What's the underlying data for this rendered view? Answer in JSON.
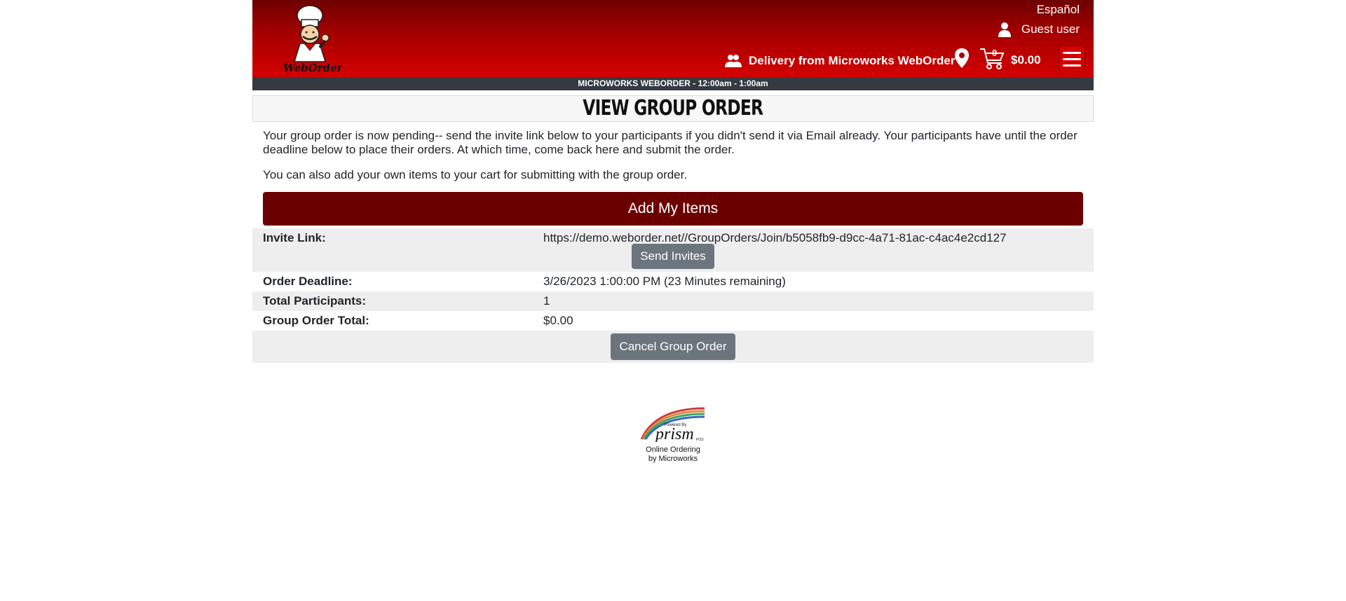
{
  "header": {
    "language_link": "Español",
    "user_name": "Guest user",
    "delivery_text": "Delivery from Microworks WebOrder",
    "cart_count": "0",
    "cart_total": "$0.00",
    "logo_text": "WebOrder"
  },
  "hours_bar": "MICROWORKS WEBORDER - 12:00am - 1:00am",
  "page_title": "View Group Order",
  "intro": {
    "paragraph1": "Your group order is now pending-- send the invite link below to your participants if you didn't send it via Email already. Your participants have until the order deadline below to place their orders. At which time, come back here and submit the order.",
    "paragraph2": "You can also add your own items to your cart for submitting with the group order."
  },
  "add_items_label": "Add My Items",
  "details": {
    "invite_label": "Invite Link:",
    "invite_url": "https://demo.weborder.net//GroupOrders/Join/b5058fb9-d9cc-4a71-81ac-c4ac4e2cd127",
    "send_invites_label": "Send Invites",
    "deadline_label": "Order Deadline:",
    "deadline_value": "3/26/2023 1:00:00 PM (23 Minutes remaining)",
    "participants_label": "Total Participants:",
    "participants_value": "1",
    "total_label": "Group Order Total:",
    "total_value": "$0.00",
    "cancel_label": "Cancel Group Order"
  },
  "footer": {
    "powered_by": "Powered By",
    "brand": "prism",
    "brand_suffix": "POS",
    "line1": "Online Ordering",
    "line2": "by Microworks"
  },
  "colors": {
    "header_dark": "#6e0000",
    "header_light": "#d40000",
    "add_button": "#6b0000",
    "gray_button": "#6c757d",
    "hours_bar": "#343a40"
  }
}
